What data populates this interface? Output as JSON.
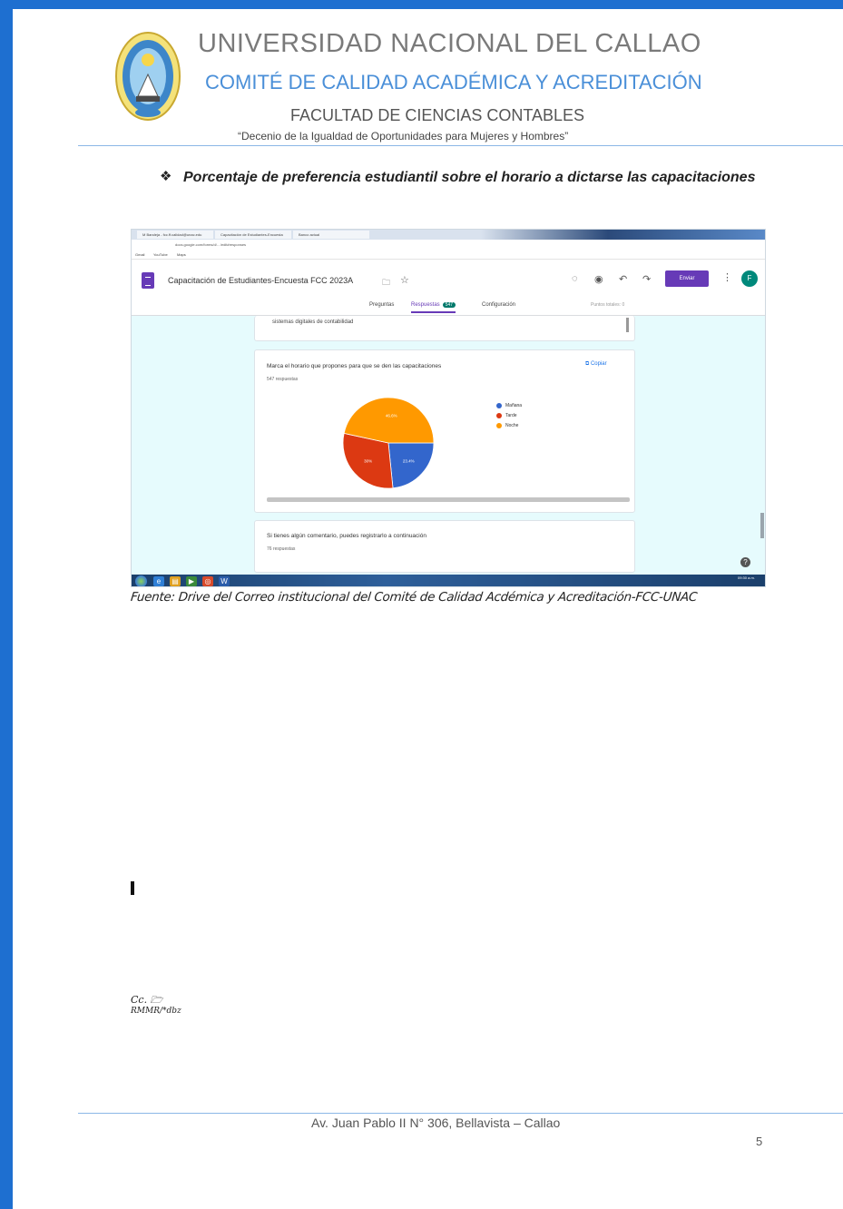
{
  "letterhead": {
    "university": "UNIVERSIDAD NACIONAL DEL CALLAO",
    "committee": "COMITÉ DE CALIDAD ACADÉMICA Y ACREDITACIÓN",
    "faculty": "FACULTAD DE CIENCIAS CONTABLES",
    "decenio": "“Decenio de la Igualdad de Oportunidades para Mujeres y Hombres”"
  },
  "section": {
    "bullet_icon": "❖",
    "heading": "Porcentaje de preferencia estudiantil sobre el horario a dictarse las capacitaciones"
  },
  "screenshot": {
    "browser_tabs": [
      "M Bandeja - fcc.ff.calidad@unac.edu",
      "Capacitación de Estudiantes-Encuesta",
      "Banco actual"
    ],
    "form_title": "Capacitación de Estudiantes-Encuesta FCC 2023A",
    "send_label": "Enviar",
    "avatar_letter": "F",
    "tabs": {
      "preguntas": "Preguntas",
      "respuestas": "Respuestas",
      "respuestas_count": "547",
      "configuracion": "Configuración",
      "puntos": "Puntos totales: 0"
    },
    "prev_card_text": "sistemas digitales de contabilidad",
    "question": "Marca el horario que propones para que se den las capacitaciones",
    "responses": "547 respuestas",
    "copy_label": "Copiar",
    "next_question": "Si tienes algún comentario, puedes registrarlo a continuación",
    "next_responses": "76 respuestas",
    "help_icon": "?",
    "clock": "09:30 a.m."
  },
  "chart_data": {
    "type": "pie",
    "title": "Marca el horario que propones para que se den las capacitaciones",
    "total_responses": 547,
    "slices": [
      {
        "label": "Mañana",
        "value": 23.4,
        "display": "23.4%",
        "color": "#3366cc"
      },
      {
        "label": "Tarde",
        "value": 30,
        "display": "30%",
        "color": "#dc3912"
      },
      {
        "label": "Noche",
        "value": 46.6,
        "display": "46.6%",
        "color": "#ff9900"
      }
    ],
    "legend_position": "right"
  },
  "source_caption": "Fuente: Drive del Correo institucional del Comité de Calidad Acdémica y Acreditación-FCC-UNAC",
  "cursor_char": "I",
  "initials": {
    "line1": "Cc. 🗁",
    "line2": "RMMR/*dbz"
  },
  "footer": {
    "address": "Av. Juan Pablo II N° 306, Bellavista – Callao",
    "page_number": "5"
  },
  "colors": {
    "border_blue": "#1e6fd0",
    "committee_blue": "#4a8fd8",
    "forms_purple": "#673ab7",
    "screenshot_bg": "#e6fbfd"
  }
}
